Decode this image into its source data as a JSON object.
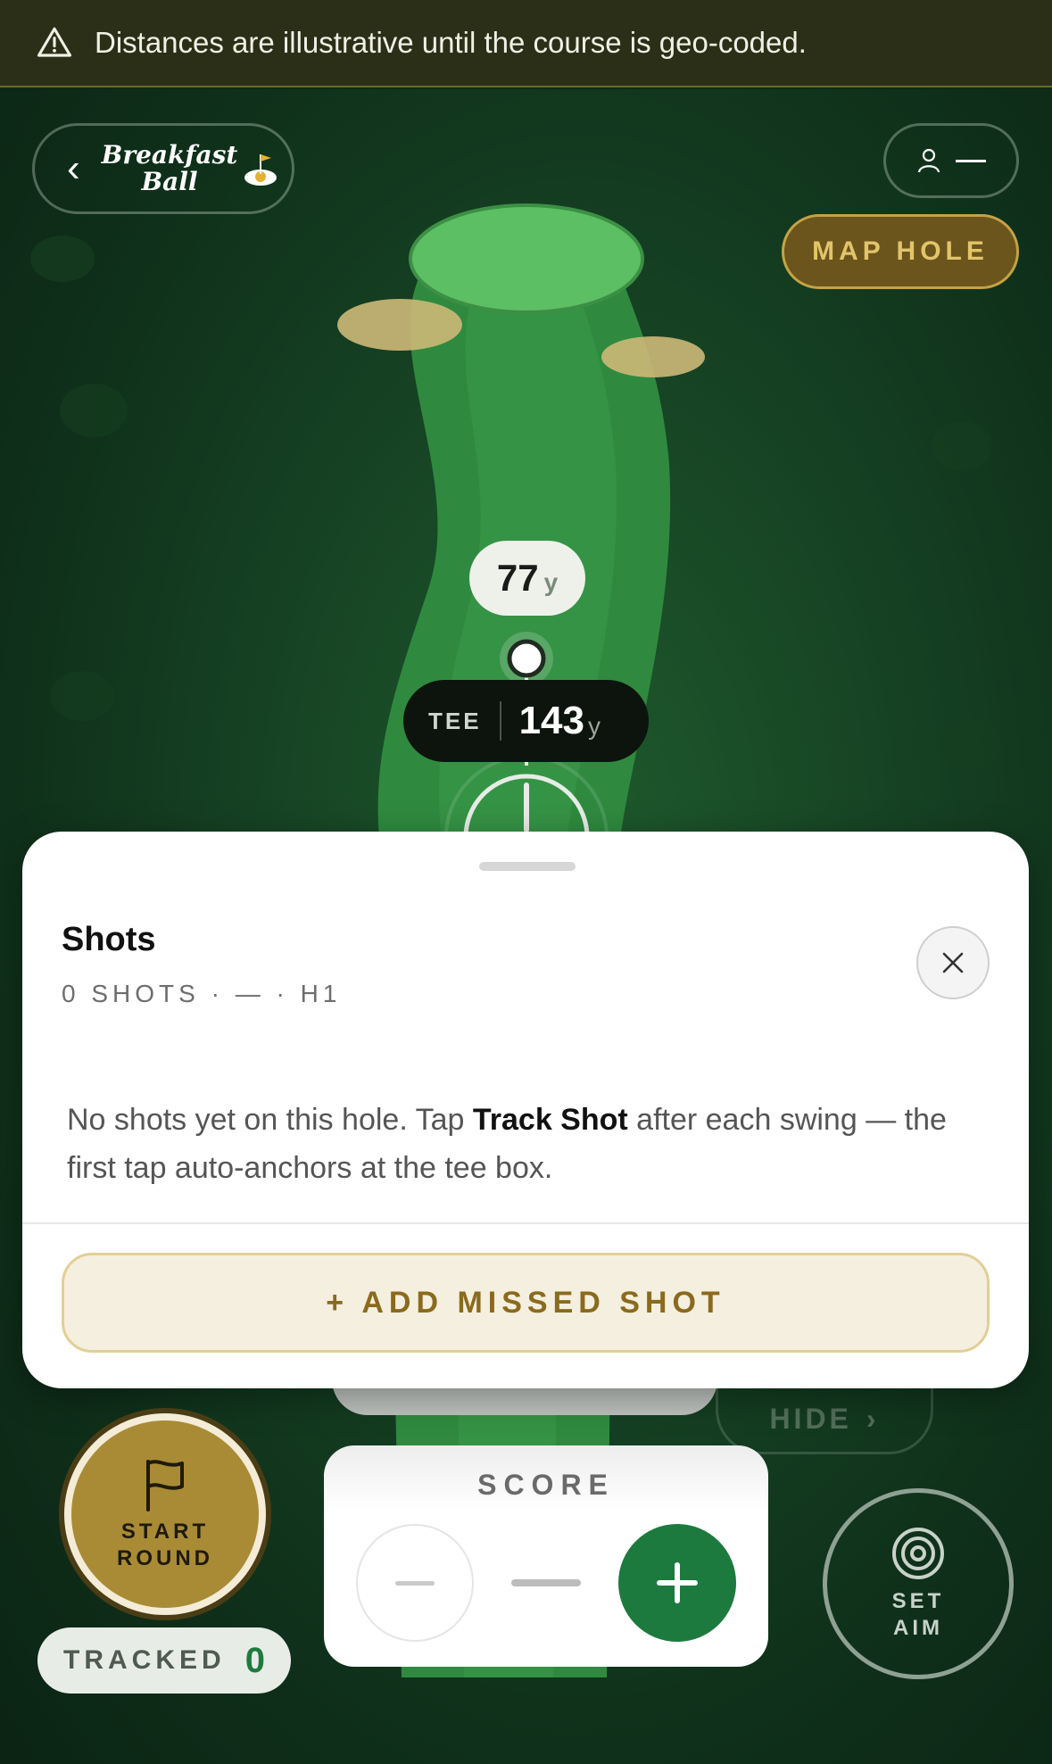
{
  "banner": {
    "text": "Distances are illustrative until the course is geo-coded."
  },
  "header": {
    "logo_line1": "Breakfast",
    "logo_line2": "Ball",
    "map_hole_label": "MAP HOLE"
  },
  "map": {
    "target_distance": "77",
    "target_unit": "y",
    "tee_label": "TEE",
    "tee_distance": "143",
    "tee_unit": "y",
    "peek_hide_label": "HIDE"
  },
  "sheet": {
    "title": "Shots",
    "subtitle": "0 SHOTS · — · H1",
    "empty_part1": "No shots yet on this hole. Tap ",
    "empty_bold": "Track Shot",
    "empty_part2": " after each swing — the first tap auto-anchors at the tee box.",
    "add_missed_label": "+ ADD MISSED SHOT"
  },
  "bottom": {
    "start_line1": "START",
    "start_line2": "ROUND",
    "tracked_label": "TRACKED",
    "tracked_count": "0",
    "score_label": "SCORE",
    "aim_line1": "SET",
    "aim_line2": "AIM"
  },
  "colors": {
    "brand_green": "#1d7a3f",
    "gold": "#a98b35",
    "map_bg": "#174525"
  }
}
